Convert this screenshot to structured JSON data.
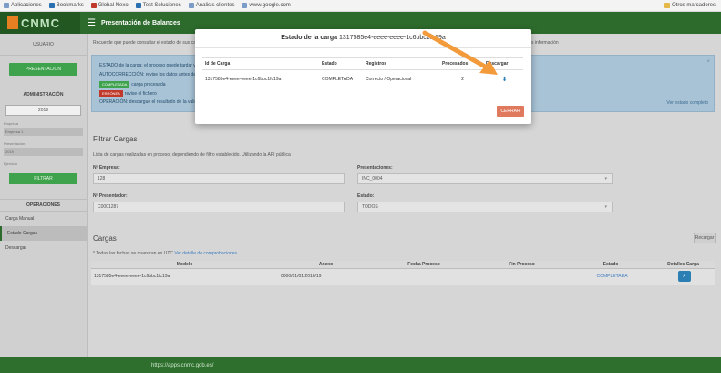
{
  "browser": {
    "bookmarks": [
      "Aplicaciones",
      "Bookmarks",
      "Global Nexo",
      "Test Soluciones",
      "Analisis clientes",
      "www.google.com"
    ],
    "bookmarks_right": "Otros marcadores"
  },
  "header": {
    "logo_text": "CNMC",
    "title": "Presentación de Balances"
  },
  "sidebar": {
    "user": "USUARIO",
    "green_button": "PRESENTACION",
    "section_admin": "ADMINISTRACIÓN",
    "select_value": "2019",
    "label1": "Empresa",
    "input1": "Empresa 1",
    "label2": "Presentación",
    "input2": "2019",
    "label3": "Ejercicio",
    "filter_button": "FILTRAR",
    "section_ops": "OPERACIONES",
    "items": [
      {
        "label": "Carga Manual"
      },
      {
        "label": "Estado Cargas"
      },
      {
        "label": "Descargar"
      }
    ]
  },
  "main": {
    "top_text": "Recuerde que puede consultar el estado de sus cargas a través del listado inferior",
    "top_text_right": "Más información",
    "info": {
      "line1": "ESTADO de la carga: el proceso puede tardar varios minutos",
      "line2": "AUTOCORRECCIÓN: revise los datos antes de enviar",
      "badge_green": "COMPLETADA",
      "line3": "carga procesada",
      "badge_red": "ERRÓNEA",
      "line4": "revise el fichero",
      "line5": "OPERACIÓN: descargue el resultado de la validación",
      "link": "Ver estado completo"
    },
    "filter_section": {
      "title": "Filtrar Cargas",
      "desc": "Lista de cargas realizadas en proceso, dependiendo de filtro establecido. Utilizando la API pública",
      "desc_link": "la API pública",
      "label_empresa": "Nº Empresa:",
      "value_empresa": "128",
      "label_presentacion": "Presentaciones:",
      "value_presentacion": "INC_0004",
      "label_presentador": "Nº Presentador:",
      "value_presentador": "C0001287",
      "label_estado": "Estado:",
      "value_estado": "TODOS"
    },
    "cargas": {
      "title": "Cargas",
      "note": "* Todas las fechas se muestran en UTC",
      "note_link": "Ver detalle de comprobaciones",
      "refresh": "Recargar",
      "headers": [
        "Modelo",
        "Anexo",
        "Fecha Proceso",
        "Fin Proceso",
        "Estado",
        "Detalles Carga"
      ],
      "rows": [
        {
          "modelo": "1317585e4-eeee-eeee-1c6bbc1fc19a",
          "anexo": "0000/01/01 2016/19",
          "fecha": "",
          "fin": "",
          "estado": "COMPLETADA"
        }
      ]
    }
  },
  "footer": {
    "text": "https://apps.cnmc.gob.es/"
  },
  "modal": {
    "title_bold": "Estado de la carga",
    "title_rest": "1317585e4-eeee-eeee-1c6bbc1fc19a",
    "headers": [
      "Id de Carga",
      "Estado",
      "Registros",
      "Procesados",
      "Descargar"
    ],
    "rows": [
      {
        "id": "1317585e4-eeee-eeee-1c6bbc1fc19a",
        "estado": "COMPLETADA",
        "registros": "Correcto / Operacional",
        "procesados": "2"
      }
    ],
    "close_button": "CERRAR"
  },
  "colors": {
    "header_green": "#2d6b2c",
    "accent_orange": "#f39a3a",
    "link_blue": "#3b7bbf"
  }
}
